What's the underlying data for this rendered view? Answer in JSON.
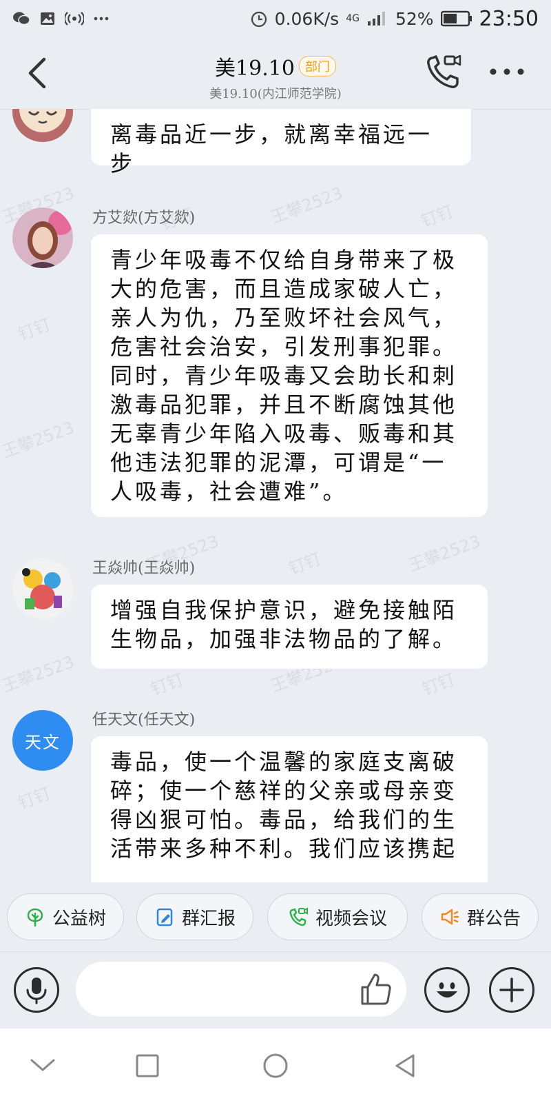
{
  "status_bar": {
    "net_speed": "0.06K/s",
    "network": "4G",
    "battery": "52%",
    "time": "23:50",
    "icons": [
      "wechat-icon",
      "image-icon",
      "broadcast-icon",
      "more-dots-icon",
      "alarm-icon",
      "signal-icon",
      "battery-icon"
    ]
  },
  "header": {
    "title": "美19.10",
    "badge": "部门",
    "subtitle": "美19.10(内江师范学院)",
    "icons": [
      "back-icon",
      "video-call-icon",
      "more-icon"
    ]
  },
  "watermark": {
    "name": "王攀2523",
    "app": "钉钉"
  },
  "messages": [
    {
      "sender": "",
      "text": "离毒品近一步，就离幸福远一步"
    },
    {
      "sender": "方艾欻(方艾欻)",
      "text": "青少年吸毒不仅给自身带来了极大的危害，而且造成家破人亡，亲人为仇，乃至败坏社会风气，危害社会治安，引发刑事犯罪。同时，青少年吸毒又会助长和刺激毒品犯罪，并且不断腐蚀其他无辜青少年陷入吸毒、贩毒和其他违法犯罪的泥潭，可谓是“一人吸毒，社会遭难”。"
    },
    {
      "sender": "王焱帅(王焱帅)",
      "text": "增强自我保护意识，避免接触陌生物品，加强非法物品的了解。"
    },
    {
      "sender": "任天文(任天文)",
      "avatar_text": "天文",
      "text": "毒品，使一个温馨的家庭支离破碎；使一个慈祥的父亲或母亲变得凶狠可怕。毒品，给我们的生活带来多种不利。我们应该携起"
    }
  ],
  "quick_actions": [
    {
      "label": "公益树",
      "icon": "tree-icon",
      "color": "#2fb24c"
    },
    {
      "label": "群汇报",
      "icon": "report-icon",
      "color": "#2d86e0"
    },
    {
      "label": "视频会议",
      "icon": "video-meeting-icon",
      "color": "#2fb24c"
    },
    {
      "label": "群公告",
      "icon": "megaphone-icon",
      "color": "#f08a1c"
    }
  ],
  "input_bar": {
    "placeholder": "",
    "icons": [
      "microphone-icon",
      "thumbs-up-icon",
      "emoji-icon",
      "add-icon"
    ]
  },
  "nav_bar": {
    "icons": [
      "nav-down-icon",
      "nav-recent-icon",
      "nav-home-icon",
      "nav-back-icon"
    ]
  },
  "colors": {
    "background": "#eaedf1",
    "bubble": "#ffffff",
    "accent_blue": "#2f8cf0",
    "badge_orange": "#f39c12"
  }
}
